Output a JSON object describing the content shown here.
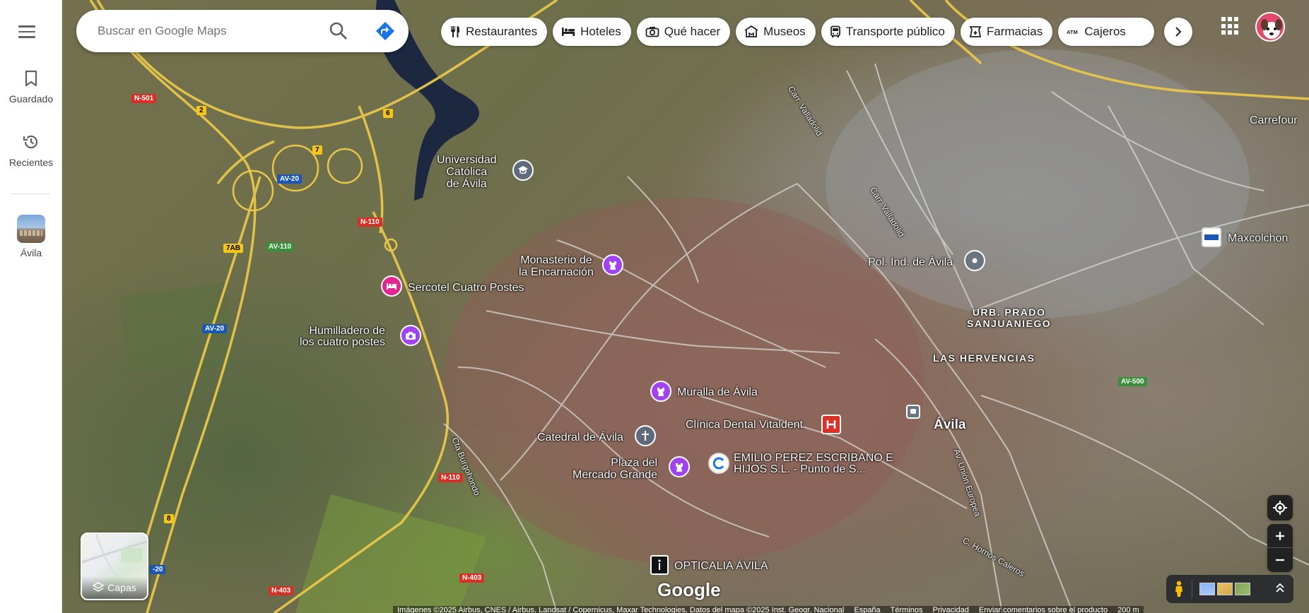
{
  "rail": {
    "saved_label": "Guardado",
    "recents_label": "Recientes",
    "recent_place_label": "Ávila"
  },
  "search": {
    "placeholder": "Buscar en Google Maps"
  },
  "chips": [
    {
      "label": "Restaurantes",
      "icon": "fork-knife-icon"
    },
    {
      "label": "Hoteles",
      "icon": "bed-icon"
    },
    {
      "label": "Qué hacer",
      "icon": "camera-icon"
    },
    {
      "label": "Museos",
      "icon": "museum-icon"
    },
    {
      "label": "Transporte público",
      "icon": "bus-icon"
    },
    {
      "label": "Farmacias",
      "icon": "pharmacy-icon"
    },
    {
      "label": "Cajeros",
      "icon": "atm-icon"
    }
  ],
  "map": {
    "places": {
      "universidad": "Universidad\nCatólica\nde Ávila",
      "monasterio": "Monasterio de\nla Encarnación",
      "sercotel": "Sercotel Cuatro Postes",
      "humilladero": "Humilladero de\nlos cuatro postes",
      "muralla": "Muralla de Ávila",
      "catedral": "Catedral de Ávila",
      "clinica": "Clínica Dental Vitaldent",
      "plaza": "Plaza del\nMercado Grande",
      "emilio": "EMILIO PEREZ ESCRIBANO E\nHIJOS S.L. - Punto de S...",
      "opticalia": "OPTICALIA ÁVILA",
      "pol_ind": "Pol. Ind. de Ávila",
      "maxcolchon": "Maxcolchon",
      "carrefour": "Carrefour",
      "urb_prado": "URB. PRADO\nSANJUANIEGO",
      "hervencias": "LAS HERVENCIAS",
      "avila_city": "Ávila"
    },
    "roads": {
      "carr_valladolid_1": "Carr. Valladolid",
      "carr_valladolid_2": "Carr. Valladolid",
      "cta_burgohondo": "Cta Burgohondo",
      "av_union_europea": "Av. Unión Europea",
      "c_hornos_caleros": "C. Hornos Caleros"
    },
    "shields": {
      "n501": "N-501",
      "two": "2",
      "six": "6",
      "seven": "7",
      "av20_a": "AV-20",
      "n110_a": "N-110",
      "seven_ab": "7AB",
      "av110": "AV-110",
      "av20_b": "AV-20",
      "n110_b": "N-110",
      "av500": "AV-500",
      "eight": "8",
      "n403_a": "N-403",
      "n403_b": "N-403",
      "av20_c": "-20"
    }
  },
  "layers_label": "Capas",
  "google_logo": "Google",
  "attribution": {
    "imagery": "Imágenes ©2025 Airbus, CNES / Airbus, Landsat / Copernicus, Maxar Technologies, Datos del mapa ©2025 Inst. Geogr. Nacional",
    "country": "España",
    "terms": "Términos",
    "privacy": "Privacidad",
    "feedback": "Enviar comentarios sobre el producto",
    "scale": "200 m"
  },
  "colors": {
    "accent_blue": "#1a73e8",
    "poi_purple": "#a142f4",
    "poi_pink": "#e52592",
    "hospital_red": "#e12f25"
  }
}
